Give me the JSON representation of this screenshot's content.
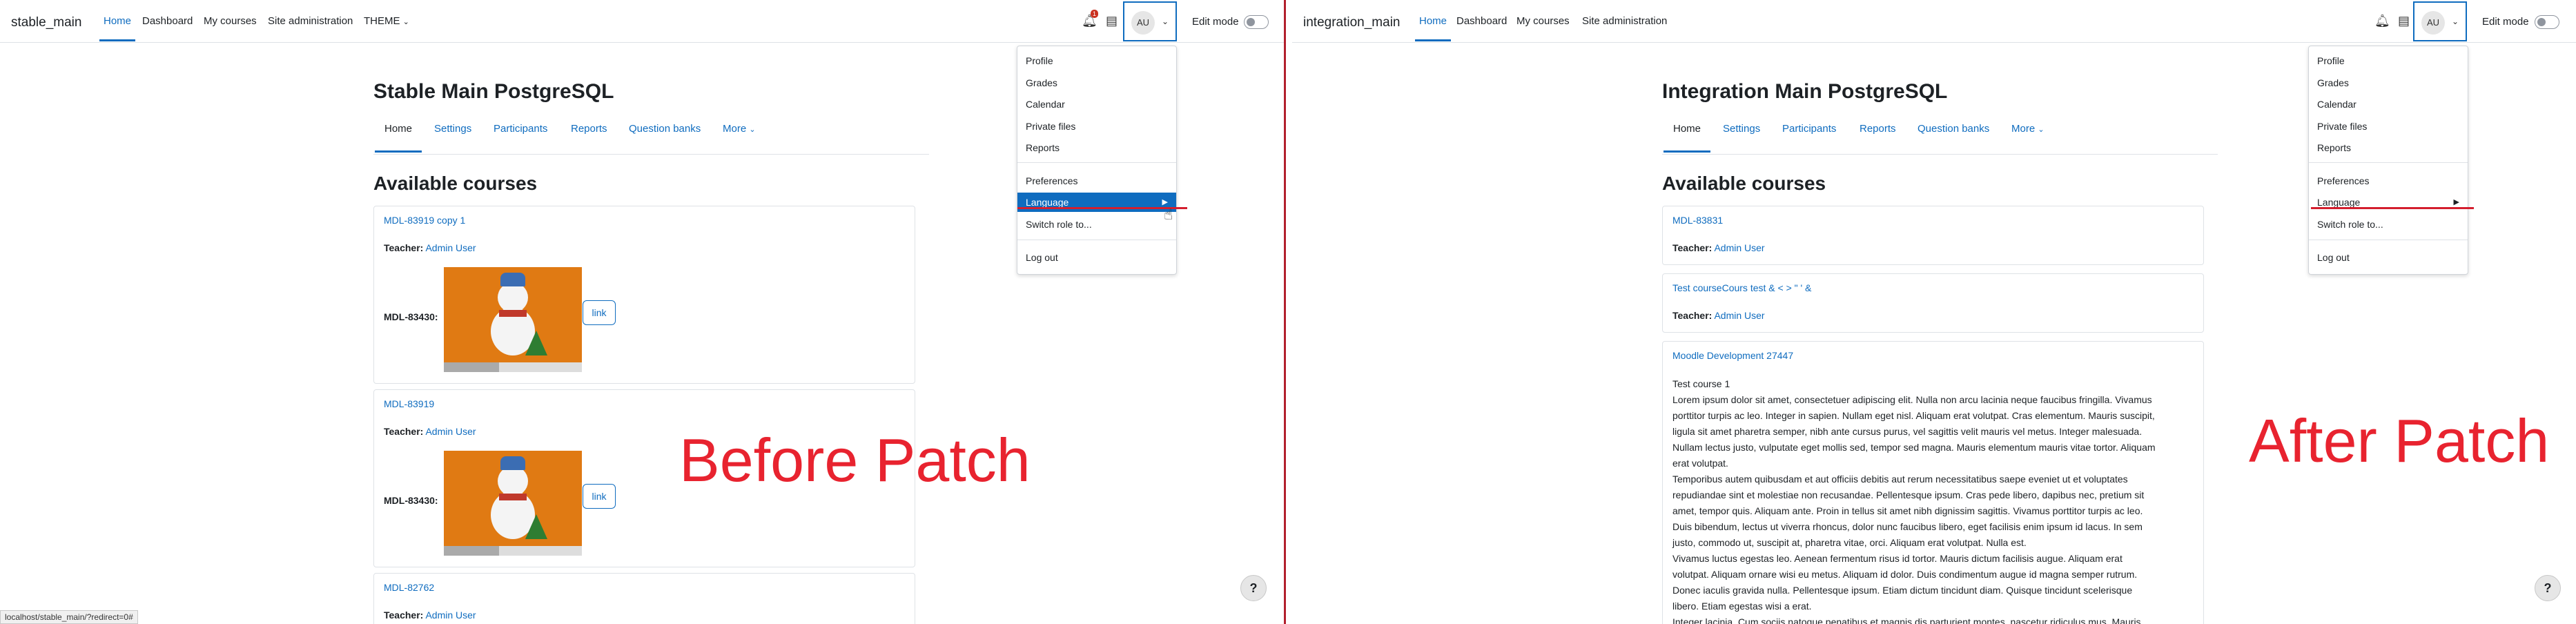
{
  "left": {
    "brand": "stable_main",
    "nav": [
      "Home",
      "Dashboard",
      "My courses",
      "Site administration",
      "THEME"
    ],
    "notification_count": "1",
    "avatar": "AU",
    "edit_mode": "Edit mode",
    "page_title": "Stable Main PostgreSQL",
    "tabs": [
      "Home",
      "Settings",
      "Participants",
      "Reports",
      "Question banks",
      "More"
    ],
    "section_title": "Available courses",
    "stray_mark": "·",
    "courses": [
      {
        "name": "MDL-83919 copy 1",
        "teacher_label": "Teacher:",
        "teacher": "Admin User",
        "field_label": "MDL-83430:",
        "link": "link"
      },
      {
        "name": "MDL-83919",
        "teacher_label": "Teacher:",
        "teacher": "Admin User",
        "field_label": "MDL-83430:",
        "link": "link"
      },
      {
        "name": "MDL-82762",
        "teacher_label": "Teacher:",
        "teacher": "Admin User"
      }
    ],
    "menu": [
      "Profile",
      "Grades",
      "Calendar",
      "Private files",
      "Reports",
      "Preferences",
      "Language",
      "Switch role to...",
      "Log out"
    ],
    "annotation": "Before Patch",
    "status_url": "localhost/stable_main/?redirect=0#",
    "help": "?"
  },
  "right": {
    "brand": "integration_main",
    "nav": [
      "Home",
      "Dashboard",
      "My courses",
      "Site administration"
    ],
    "avatar": "AU",
    "edit_mode": "Edit mode",
    "page_title": "Integration Main PostgreSQL",
    "tabs": [
      "Home",
      "Settings",
      "Participants",
      "Reports",
      "Question banks",
      "More"
    ],
    "section_title": "Available courses",
    "courses": [
      {
        "name": "MDL-83831",
        "teacher_label": "Teacher:",
        "teacher": "Admin User"
      },
      {
        "name": "Test courseCours test & < > \" ' &",
        "teacher_label": "Teacher:",
        "teacher": "Admin User"
      },
      {
        "name": "Moodle Development 27447"
      }
    ],
    "course_summary": [
      "Test course 1",
      "Lorem ipsum dolor sit amet, consectetuer adipiscing elit. Nulla non arcu lacinia neque faucibus fringilla. Vivamus",
      "porttitor turpis ac leo. Integer in sapien. Nullam eget nisl. Aliquam erat volutpat. Cras elementum. Mauris suscipit,",
      "ligula sit amet pharetra semper, nibh ante cursus purus, vel sagittis velit mauris vel metus. Integer malesuada.",
      "Nullam lectus justo, vulputate eget mollis sed, tempor sed magna. Mauris elementum mauris vitae tortor. Aliquam",
      "erat volutpat.",
      "Temporibus autem quibusdam et aut officiis debitis aut rerum necessitatibus saepe eveniet ut et voluptates",
      "repudiandae sint et molestiae non recusandae. Pellentesque ipsum. Cras pede libero, dapibus nec, pretium sit",
      "amet, tempor quis. Aliquam ante. Proin in tellus sit amet nibh dignissim sagittis. Vivamus porttitor turpis ac leo.",
      "Duis bibendum, lectus ut viverra rhoncus, dolor nunc faucibus libero, eget facilisis enim ipsum id lacus. In sem",
      "justo, commodo ut, suscipit at, pharetra vitae, orci. Aliquam erat volutpat. Nulla est.",
      "Vivamus luctus egestas leo. Aenean fermentum risus id tortor. Mauris dictum facilisis augue. Aliquam erat",
      "volutpat. Aliquam ornare wisi eu metus. Aliquam id dolor. Duis condimentum augue id magna semper rutrum.",
      "Donec iaculis gravida nulla. Pellentesque ipsum. Etiam dictum tincidunt diam. Quisque tincidunt scelerisque",
      "libero. Etiam egestas wisi a erat.",
      "Integer lacinia. Cum sociis natoque penatibus et magnis dis parturient montes, nascetur ridiculus mus. Mauris"
    ],
    "menu": [
      "Profile",
      "Grades",
      "Calendar",
      "Private files",
      "Reports",
      "Preferences",
      "Language",
      "Switch role to...",
      "Log out"
    ],
    "annotation": "After Patch",
    "help": "?"
  },
  "colors": {
    "primary": "#0f6cbf",
    "annotation_red": "#e8232f",
    "underline_red": "#d41e2e",
    "badge": "#ca3120"
  },
  "icons": [
    "bell-icon",
    "chat-icon",
    "chevron-down-icon",
    "chevron-right-icon",
    "help-icon",
    "cursor-icon"
  ]
}
